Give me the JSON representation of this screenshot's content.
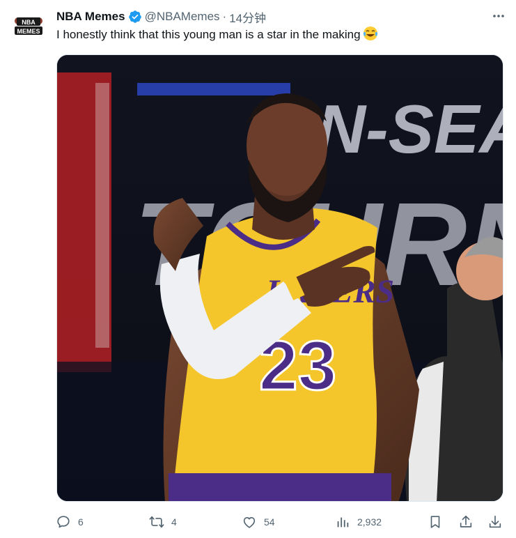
{
  "tweet": {
    "author": {
      "name": "NBA Memes",
      "handle": "@NBAMemes",
      "avatar_text": "NBA MEMES",
      "verified": true
    },
    "separator": "·",
    "time": "14分钟",
    "text": "I honestly think that this young man is a star in the making",
    "emoji": "face-with-tears-of-joy",
    "media": {
      "description_icon": "photo",
      "jersey_number": "23",
      "jersey_team": "LAKERS",
      "background_sign": "IN-SEASON TOURNAMENT"
    },
    "actions": {
      "replies": "6",
      "retweets": "4",
      "likes": "54",
      "views": "2,932"
    },
    "colors": {
      "verified": "#1d9bf0",
      "secondary_text": "#536471",
      "jersey_gold": "#f5c62c",
      "jersey_purple": "#4b2c86"
    }
  }
}
